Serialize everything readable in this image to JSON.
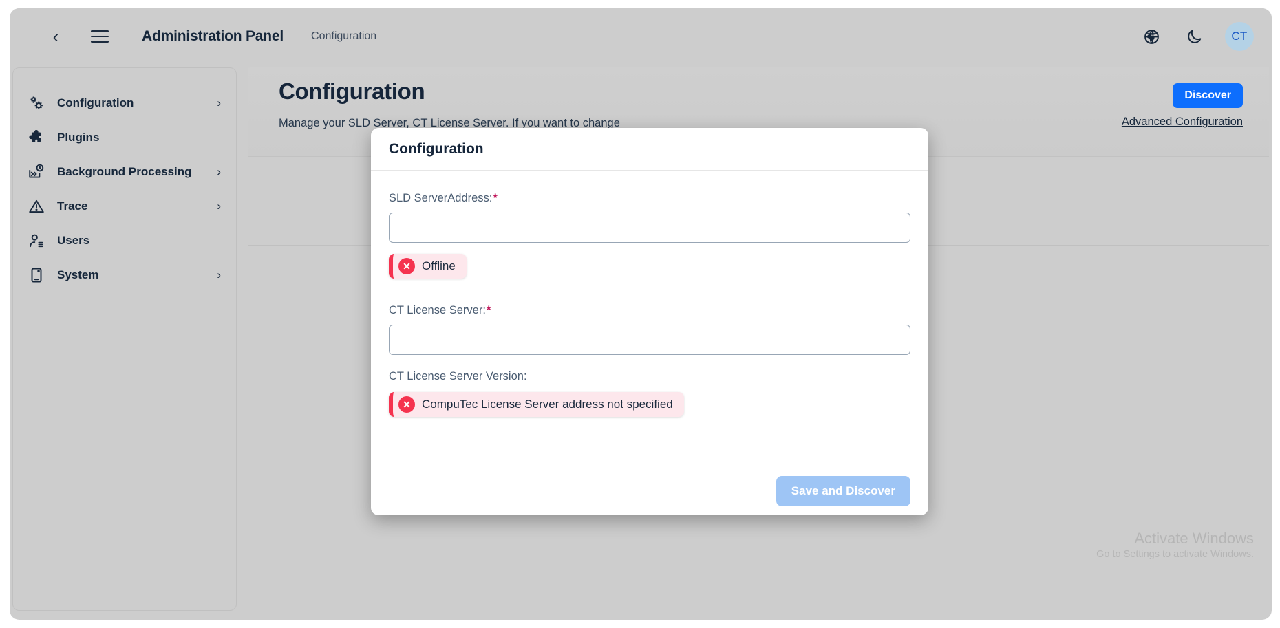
{
  "topbar": {
    "back_icon": "chevron-left-icon",
    "menu_icon": "hamburger-menu-icon",
    "title": "Administration Panel",
    "subtitle": "Configuration",
    "language_icon": "globe-icon",
    "theme_icon": "moon-icon",
    "avatar_initials": "CT"
  },
  "sidebar": {
    "items": [
      {
        "label": "Configuration",
        "icon": "gears-icon",
        "has_chevron": true
      },
      {
        "label": "Plugins",
        "icon": "puzzle-piece-icon",
        "has_chevron": false
      },
      {
        "label": "Background Processing",
        "icon": "process-clock-icon",
        "has_chevron": true
      },
      {
        "label": "Trace",
        "icon": "warning-triangle-icon",
        "has_chevron": true
      },
      {
        "label": "Users",
        "icon": "user-list-icon",
        "has_chevron": true
      },
      {
        "label": "System",
        "icon": "device-icon",
        "has_chevron": true
      }
    ]
  },
  "page": {
    "title": "Configuration",
    "discover_button": "Discover",
    "description": "Manage your SLD Server, CT License Server. If you want to change",
    "advanced_link": "Advanced Configuration"
  },
  "modal": {
    "title": "Configuration",
    "fields": [
      {
        "label": "SLD ServerAddress:",
        "required": true,
        "value": "",
        "placeholder": ""
      },
      {
        "label": "CT License Server:",
        "required": true,
        "value": "",
        "placeholder": ""
      }
    ],
    "sld_status": {
      "icon": "error-circle-x-icon",
      "text": "Offline"
    },
    "version_label": "CT License Server Version:",
    "version_status": {
      "icon": "error-circle-x-icon",
      "text": "CompuTec License Server address not specified"
    },
    "save_button": "Save and Discover"
  },
  "watermark": {
    "line1": "Activate Windows",
    "line2": "Go to Settings to activate Windows."
  },
  "colors": {
    "accent_blue": "#0d6efd",
    "error_red": "#f5334f",
    "error_bg": "#fde7ec",
    "required_star": "#c2185b",
    "avatar_bg": "#b4d2e6",
    "avatar_fg": "#1756c4",
    "shell_bg": "#cdcdcd"
  }
}
